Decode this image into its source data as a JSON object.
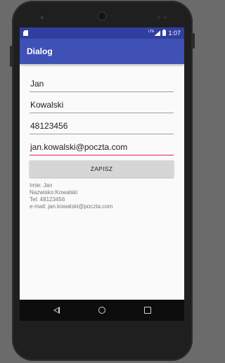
{
  "status_bar": {
    "time": "1:07",
    "network": "LTE"
  },
  "app_bar": {
    "title": "Dialog"
  },
  "form": {
    "first_name": "Jan",
    "last_name": "Kowalski",
    "phone": "48123456",
    "email": "jan.kowalski@poczta.com",
    "save_label": "ZAPISZ"
  },
  "output": {
    "line1": "Imie: Jan",
    "line2": "Nazwisko:Kowalski",
    "line3": "Tel: 48123456",
    "line4": "e-mail: jan.kowalski@poczta.com"
  },
  "colors": {
    "status_bar": "#303f9f",
    "app_bar": "#3f51b5",
    "accent": "#e91e63"
  },
  "icons": [
    "sd-card-icon",
    "signal-icon",
    "battery-icon",
    "back-icon",
    "home-icon",
    "recents-icon"
  ]
}
